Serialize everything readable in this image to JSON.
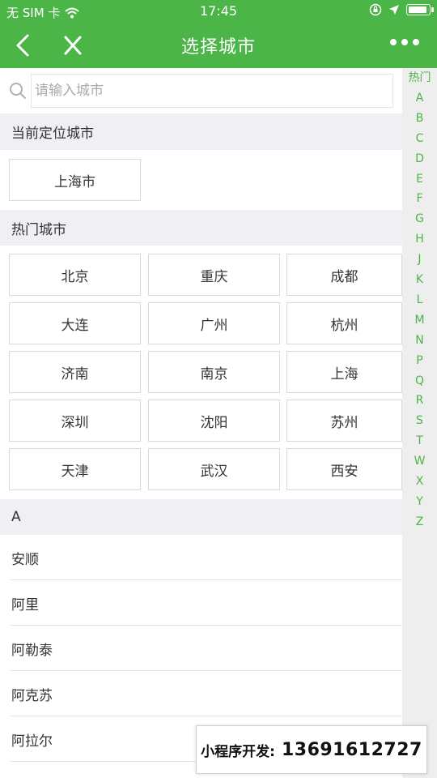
{
  "status_bar": {
    "carrier": "无 SIM 卡",
    "time": "17:45",
    "battery_level": 0.9
  },
  "nav": {
    "title": "选择城市"
  },
  "search": {
    "placeholder": "请输入城市",
    "value": ""
  },
  "current_location": {
    "title": "当前定位城市",
    "city": "上海市"
  },
  "hot_cities": {
    "title": "热门城市",
    "cities": [
      "北京",
      "重庆",
      "成都",
      "大连",
      "广州",
      "杭州",
      "济南",
      "南京",
      "上海",
      "深圳",
      "沈阳",
      "苏州",
      "天津",
      "武汉",
      "西安"
    ]
  },
  "groups": [
    {
      "letter": "A",
      "cities": [
        "安顺",
        "阿里",
        "阿勒泰",
        "阿克苏",
        "阿拉尔"
      ]
    }
  ],
  "index_bar": [
    "热门",
    "A",
    "B",
    "C",
    "D",
    "E",
    "F",
    "G",
    "H",
    "J",
    "K",
    "L",
    "M",
    "N",
    "P",
    "Q",
    "R",
    "S",
    "T",
    "W",
    "X",
    "Y",
    "Z"
  ],
  "promo": {
    "label": "小程序开发:",
    "phone": "13691612727"
  },
  "colors": {
    "brand": "#4cb548",
    "section_bg": "#efeff4",
    "index_bg": "#eeeeee"
  }
}
